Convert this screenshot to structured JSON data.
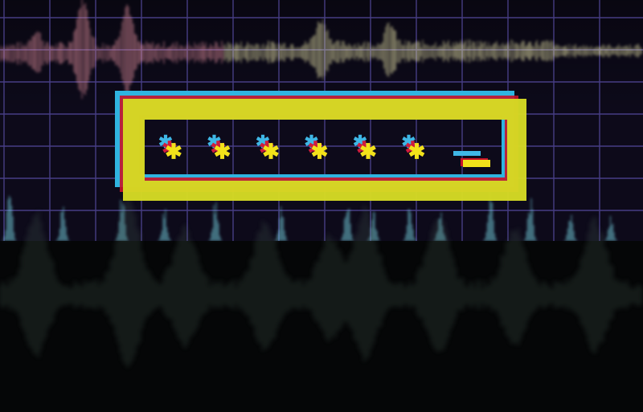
{
  "password_field": {
    "masked_char_count": 6,
    "cursor_visible": true
  },
  "colors": {
    "frame_yellow": "#d6dc24",
    "frame_cyan": "#2fb4e0",
    "frame_red": "#c8122a",
    "asterisk_yellow": "#f2e21a",
    "asterisk_cyan": "#3fb7e6",
    "asterisk_red": "#d01b3c",
    "grid": "#5a4fa8",
    "background": "#0d0a1a",
    "wave_pink": "#d98a98",
    "wave_cream": "#e6e2a8",
    "wave_cyan": "#7fe0ee",
    "lower_band": "#050606",
    "lower_wave": "#4c6258"
  },
  "icons": {
    "mask_glyph": "asterisk-icon",
    "cursor": "text-cursor-icon"
  }
}
